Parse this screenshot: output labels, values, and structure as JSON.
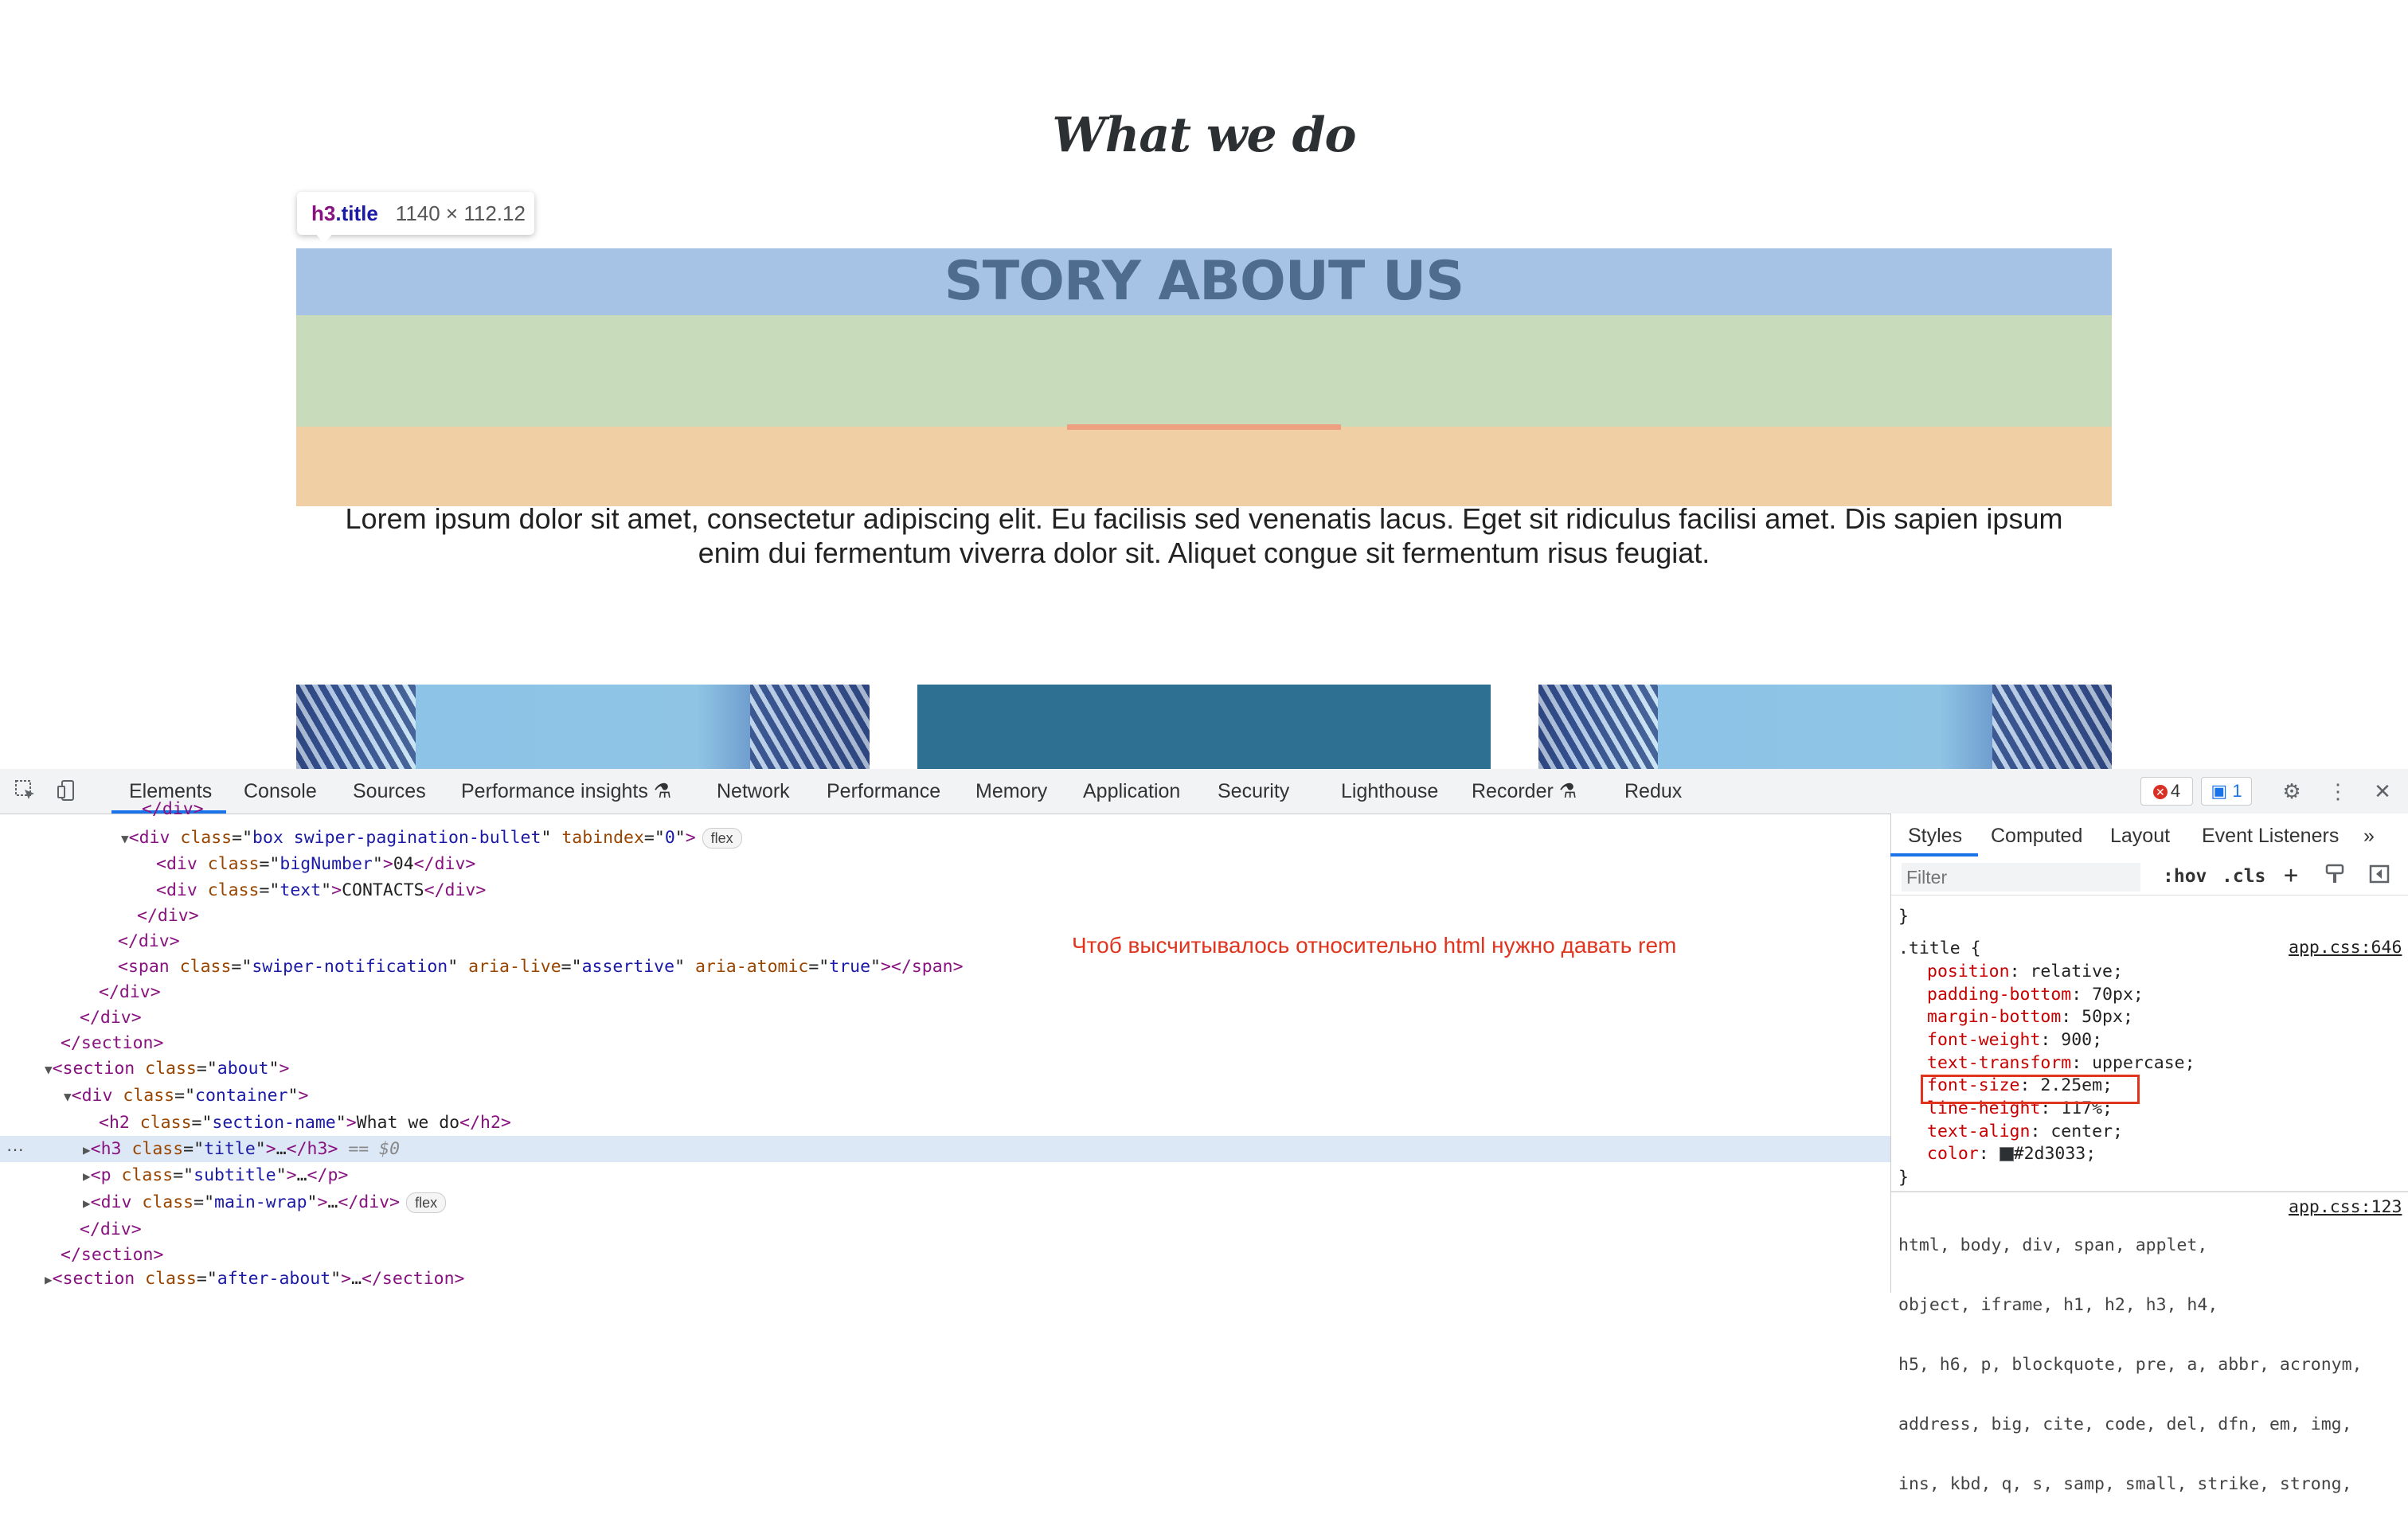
{
  "page": {
    "section_title": "What we do",
    "inspect_tooltip": {
      "tag": "h3",
      "selector": ".title",
      "dimensions": "1140 × 112.12"
    },
    "title": "STORY ABOUT US",
    "subtitle_line1": "Lorem ipsum dolor sit amet, consectetur adipiscing elit. Eu facilisis sed venenatis lacus. Eget sit ridiculus facilisi amet. Dis sapien ipsum",
    "subtitle_line2": "enim dui fermentum viverra dolor sit. Aliquet congue sit fermentum risus feugiat."
  },
  "devtools": {
    "tabs": [
      "Elements",
      "Console",
      "Sources",
      "Performance insights",
      "Network",
      "Performance",
      "Memory",
      "Application",
      "Security",
      "Lighthouse",
      "Recorder",
      "Redux"
    ],
    "active_tab": "Elements",
    "error_count": "4",
    "issue_count": "1",
    "annotation": "Чтоб высчитывалось относительно html нужно давать rem",
    "dom": {
      "l0": "</div>",
      "l1_tag": "div",
      "l1_class": "box swiper-pagination-bullet",
      "l1_tabindex": "0",
      "l1_pill": "flex",
      "l2_tag": "div",
      "l2_class": "bigNumber",
      "l2_text": "04",
      "l3_tag": "div",
      "l3_class": "text",
      "l3_text": "CONTACTS",
      "l4": "</div>",
      "l5": "</div>",
      "l6_tag": "span",
      "l6_class": "swiper-notification",
      "l6_live": "assertive",
      "l6_atomic": "true",
      "l7": "</div>",
      "l8": "</div>",
      "l9": "</section>",
      "l10_tag": "section",
      "l10_class": "about",
      "l11_tag": "div",
      "l11_class": "container",
      "l12_tag": "h2",
      "l12_class": "section-name",
      "l12_text": "What we do",
      "l13_tag": "h3",
      "l13_class": "title",
      "l13_marker": "== $0",
      "l14_tag": "p",
      "l14_class": "subtitle",
      "l15_tag": "div",
      "l15_class": "main-wrap",
      "l15_pill": "flex",
      "l16": "</div>",
      "l17": "</section>",
      "l18_tag": "section",
      "l18_class": "after-about"
    },
    "styles": {
      "tabs": [
        "Styles",
        "Computed",
        "Layout",
        "Event Listeners"
      ],
      "filter_placeholder": "Filter",
      "hov": ":hov",
      "cls": ".cls",
      "rule1_selector": ".title {",
      "rule1_source": "app.css:646",
      "rule1_props": [
        {
          "name": "position",
          "value": "relative;"
        },
        {
          "name": "padding-bottom",
          "value": "70px;"
        },
        {
          "name": "margin-bottom",
          "value": "50px;"
        },
        {
          "name": "font-weight",
          "value": "900;"
        },
        {
          "name": "text-transform",
          "value": "uppercase;"
        },
        {
          "name": "font-size",
          "value": "2.25em;"
        },
        {
          "name": "line-height",
          "value": "117%;"
        },
        {
          "name": "text-align",
          "value": "center;"
        },
        {
          "name": "color",
          "value": "#2d3033;"
        }
      ],
      "rule2_source": "app.css:123",
      "rule2_selector_lines": [
        "html, body, div, span, applet,",
        "object, iframe, h1, h2, h3, h4,",
        "h5, h6, p, blockquote, pre, a, abbr, acronym,",
        "address, big, cite, code, del, dfn, em, img,",
        "ins, kbd, q, s, samp, small, strike, strong,"
      ]
    }
  }
}
